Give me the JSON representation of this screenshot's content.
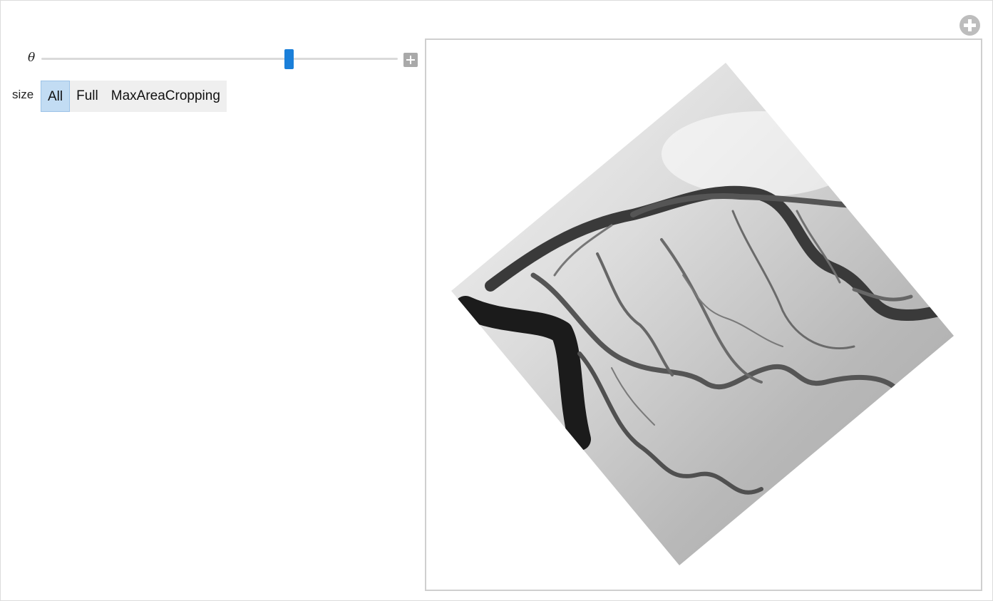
{
  "controls": {
    "theta_label": "θ",
    "theta_fraction": 0.7,
    "size_label": "size",
    "size_options": [
      "All",
      "Full",
      "MaxAreaCropping"
    ],
    "size_selected": "All"
  },
  "colors": {
    "accent": "#1a7fd9",
    "selected_bg": "#c2dcf3",
    "panel_border": "#cfcfcf"
  },
  "icons": {
    "corner": "plus-circle-icon",
    "slider_expand": "plus-square-icon"
  }
}
